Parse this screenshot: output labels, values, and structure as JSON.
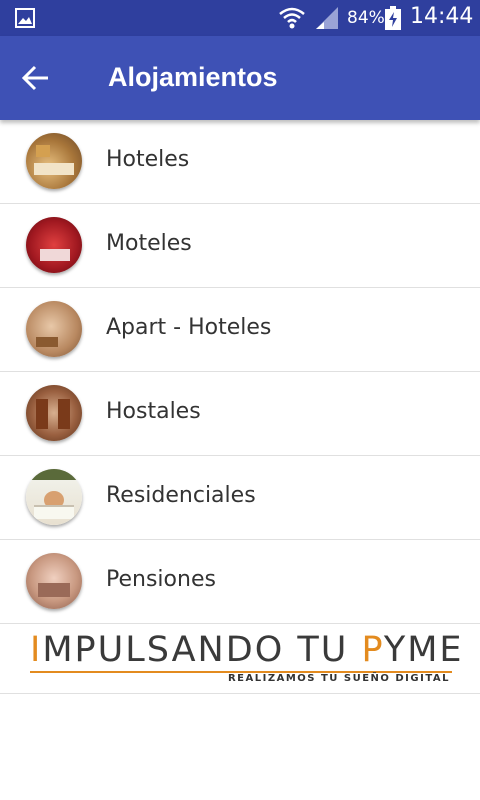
{
  "status_bar": {
    "battery": "84%",
    "time": "14:44"
  },
  "app_bar": {
    "title": "Alojamientos"
  },
  "list": {
    "items": [
      {
        "label": "Hoteles"
      },
      {
        "label": "Moteles"
      },
      {
        "label": "Apart - Hoteles"
      },
      {
        "label": "Hostales"
      },
      {
        "label": "Residenciales"
      },
      {
        "label": "Pensiones"
      }
    ]
  },
  "banner": {
    "brand_parts": [
      "I",
      "MPULSANDO TU ",
      "P",
      "YME"
    ],
    "tagline": "REALIZAMOS TU SUEÑO DIGITAL"
  },
  "colors": {
    "status_bar": "#2f3f9e",
    "app_bar": "#3e51b5",
    "banner_accent": "#e38b1f"
  }
}
